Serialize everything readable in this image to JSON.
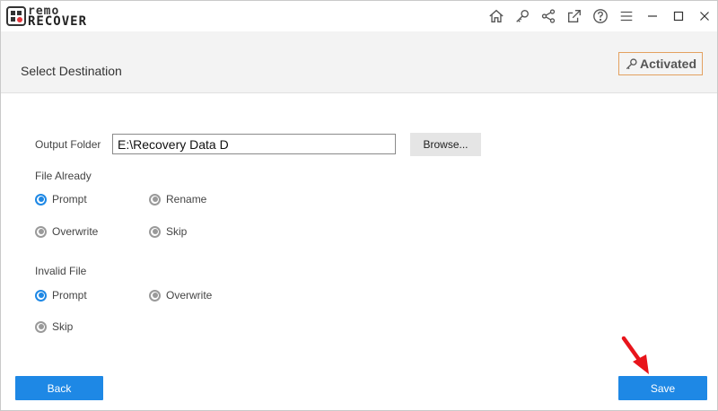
{
  "app": {
    "logo_top": "remo",
    "logo_bottom": "RECOVER",
    "toolbar_icons": [
      "home-icon",
      "key-icon",
      "share-icon",
      "export-icon",
      "help-icon",
      "menu-icon"
    ],
    "window_controls": [
      "minimize-icon",
      "maximize-icon",
      "close-icon"
    ]
  },
  "header": {
    "title": "Select Destination",
    "activated_label": "Activated",
    "activated_border_color": "#e3a160"
  },
  "form": {
    "output_folder_label": "Output Folder",
    "output_folder_value": "E:\\Recovery Data D",
    "browse_label": "Browse...",
    "file_already": {
      "label": "File Already",
      "options": [
        {
          "label": "Prompt",
          "selected": true
        },
        {
          "label": "Rename",
          "selected": false
        },
        {
          "label": "Overwrite",
          "selected": false
        },
        {
          "label": "Skip",
          "selected": false
        }
      ]
    },
    "invalid_file": {
      "label": "Invalid File",
      "options": [
        {
          "label": "Prompt",
          "selected": true
        },
        {
          "label": "Overwrite",
          "selected": false
        },
        {
          "label": "Skip",
          "selected": false
        }
      ]
    }
  },
  "footer": {
    "back_label": "Back",
    "save_label": "Save"
  },
  "colors": {
    "accent": "#1e88e5",
    "annotation_arrow": "#e8141b"
  }
}
